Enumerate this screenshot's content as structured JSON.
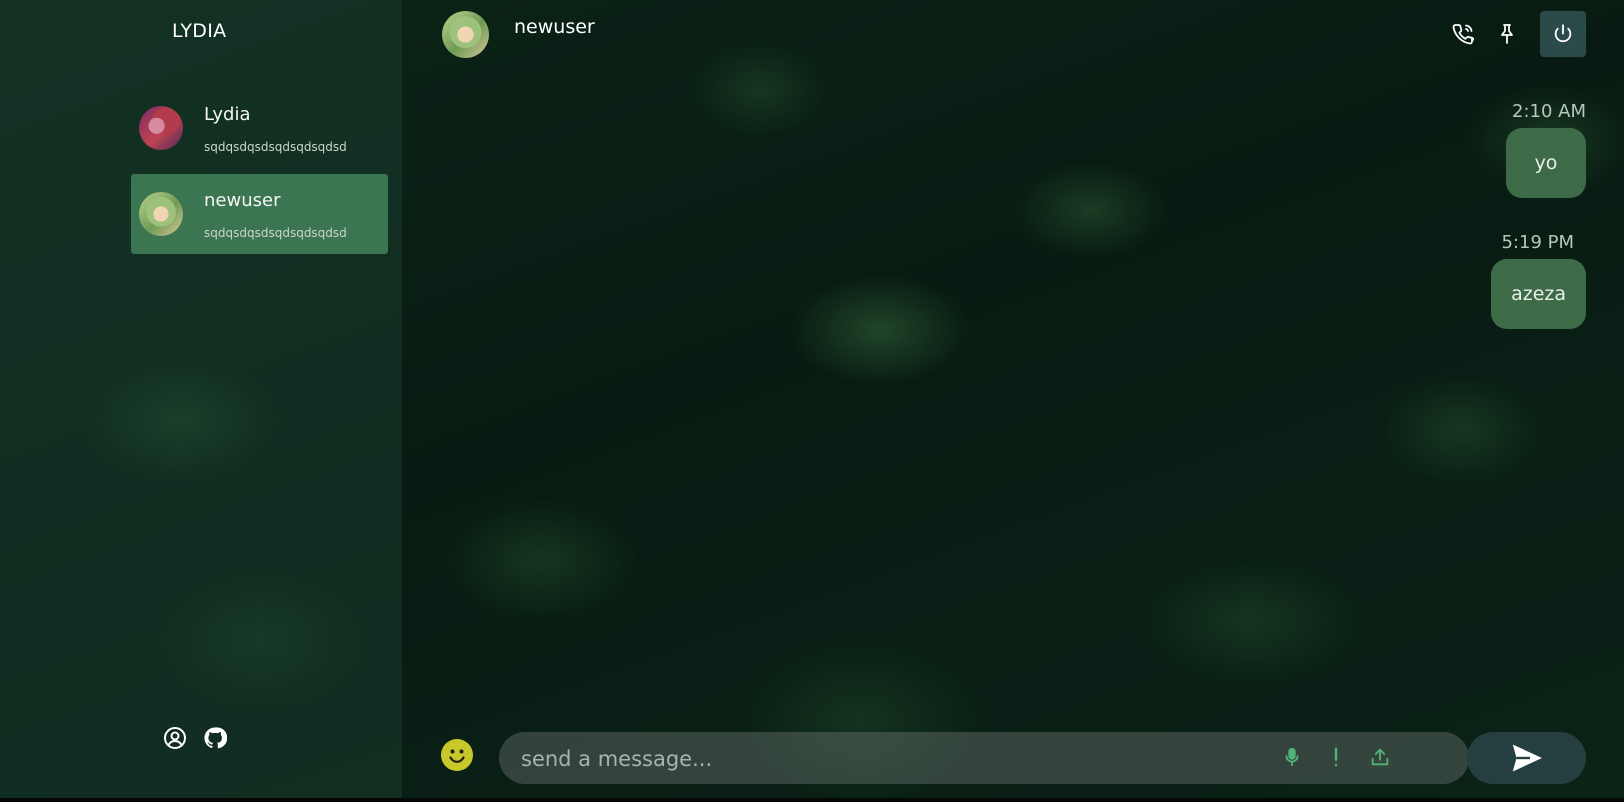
{
  "sidebar": {
    "title": "LYDIA",
    "contacts": [
      {
        "name": "Lydia",
        "preview": "sqdqsdqsdsqdsqdsqdsd",
        "active": false
      },
      {
        "name": "newuser",
        "preview": "sqdqsdqsdsqdsqdsqdsd",
        "active": true
      }
    ],
    "footer_icons": [
      "user-circle-icon",
      "github-icon"
    ]
  },
  "chat": {
    "contact_name": "newuser",
    "header_icons": [
      "phone-call-icon",
      "pin-icon",
      "power-icon"
    ],
    "messages": [
      {
        "time": "2:10 AM",
        "text": "yo"
      },
      {
        "time": "5:19 PM",
        "text": "azeza"
      }
    ]
  },
  "composer": {
    "placeholder": "send a message...",
    "value": "",
    "icons": [
      "emoji-icon",
      "microphone-icon",
      "exclamation-icon",
      "upload-icon",
      "send-icon"
    ]
  },
  "colors": {
    "accent": "#3b7551",
    "bubble": "#3d6a47",
    "power_button": "#2b4a4a",
    "send_button": "#253f40",
    "emoji": "#c8c82a",
    "tool_icons": "#4fb37a"
  }
}
